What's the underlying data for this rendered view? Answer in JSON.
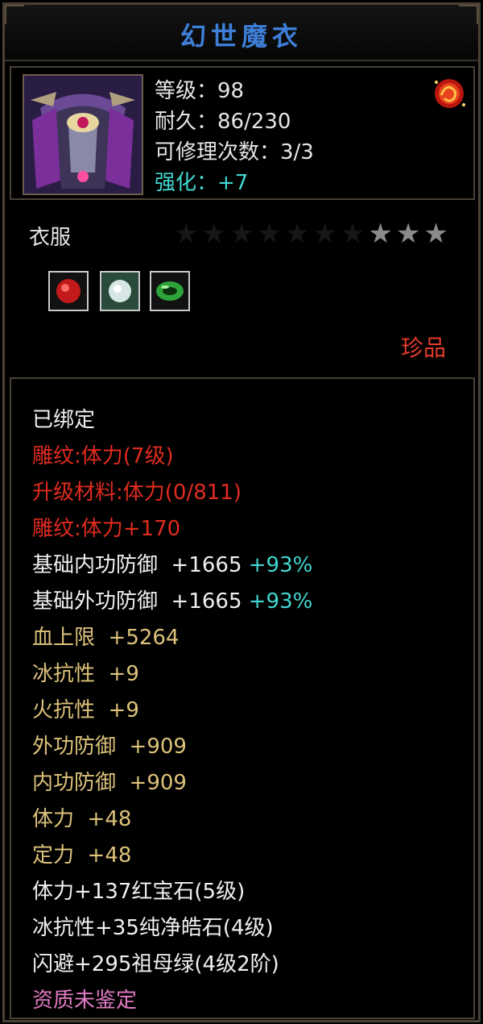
{
  "item": {
    "name": "幻世魔衣",
    "level": "等级：98",
    "durability": "耐久：86/230",
    "repair": "可修理次数：3/3",
    "enhance": "强化：+7",
    "type": "衣服",
    "stars_total": 10,
    "stars_lit": 3,
    "quality": "珍品"
  },
  "sockets": [
    {
      "name": "ruby",
      "color": "#c21a1a"
    },
    {
      "name": "diamond",
      "color": "#d8e6e6"
    },
    {
      "name": "emerald",
      "color": "#2ea33a"
    }
  ],
  "attributes": {
    "bound": "已绑定",
    "engrave1": "雕纹:体力(7级)",
    "upgrade_mat": "升级材料:体力(0/811)",
    "engrave2": "雕纹:体力+170",
    "base_inner_def": "基础内功防御  +1665",
    "base_inner_def_pct": "+93%",
    "base_outer_def": "基础外功防御  +1665",
    "base_outer_def_pct": "+93%",
    "hp_max": "血上限  +5264",
    "ice_res": "冰抗性  +9",
    "fire_res": "火抗性  +9",
    "outer_def": "外功防御  +909",
    "inner_def": "内功防御  +909",
    "stamina": "体力  +48",
    "focus": "定力  +48",
    "gem1": "体力+137红宝石(5级)",
    "gem2": "冰抗性+35纯净皓石(4级)",
    "gem3": "闪避+295祖母绿(4级2阶)",
    "aptitude": "资质未鉴定"
  }
}
